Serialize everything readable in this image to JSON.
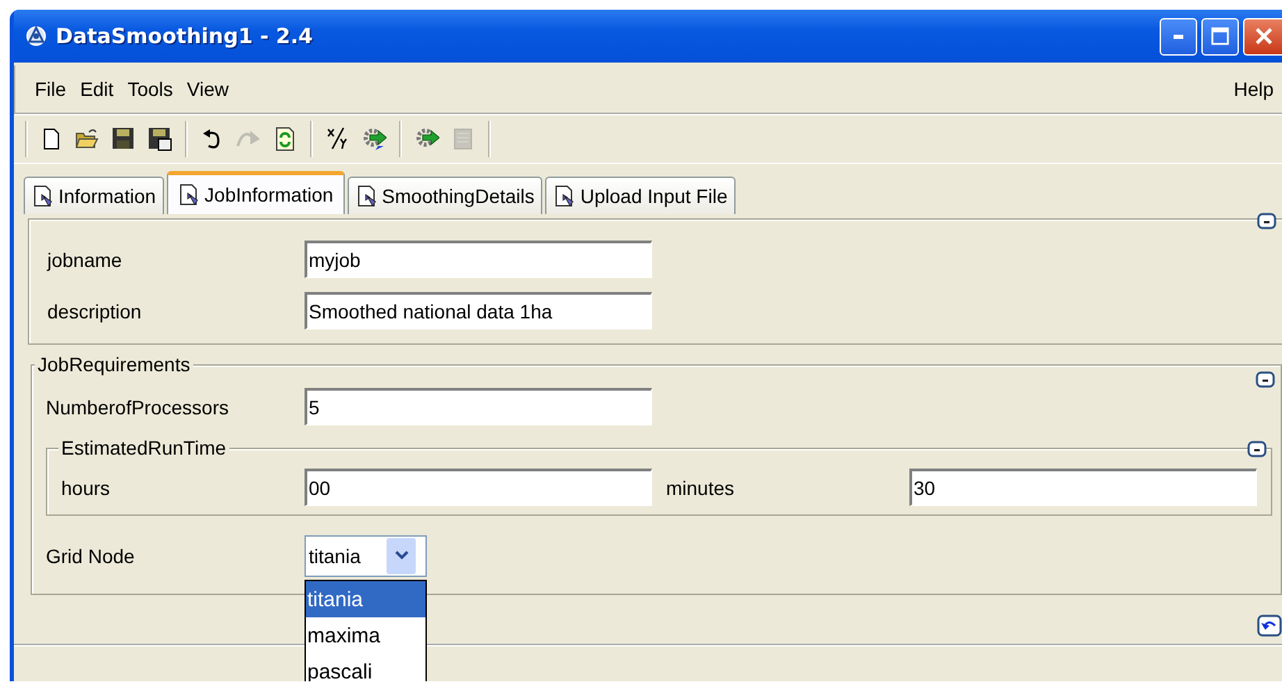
{
  "window": {
    "title": "DataSmoothing1 - 2.4"
  },
  "menu": {
    "items": [
      "File",
      "Edit",
      "Tools",
      "View"
    ],
    "help": "Help"
  },
  "toolbar": [
    {
      "kind": "new",
      "disabled": false
    },
    {
      "kind": "open",
      "disabled": false
    },
    {
      "kind": "save",
      "disabled": false
    },
    {
      "kind": "saveas",
      "disabled": false
    },
    {
      "kind": "separator"
    },
    {
      "kind": "undo",
      "disabled": false
    },
    {
      "kind": "redo",
      "disabled": true
    },
    {
      "kind": "refresh",
      "disabled": false
    },
    {
      "kind": "separator"
    },
    {
      "kind": "xy",
      "disabled": false
    },
    {
      "kind": "gearcheck",
      "disabled": false
    },
    {
      "kind": "separator"
    },
    {
      "kind": "gear",
      "disabled": false
    },
    {
      "kind": "doc",
      "disabled": true
    },
    {
      "kind": "separator"
    }
  ],
  "tabs": [
    {
      "label": "Information",
      "selected": false
    },
    {
      "label": "JobInformation",
      "selected": true
    },
    {
      "label": "SmoothingDetails",
      "selected": false
    },
    {
      "label": "Upload Input File",
      "selected": false
    }
  ],
  "job": {
    "fields": [
      {
        "label": "jobname",
        "value": "myjob"
      },
      {
        "label": "description",
        "value": "Smoothed national data 1ha"
      }
    ]
  },
  "requirements": {
    "title": "JobRequirements",
    "processors": {
      "label": "NumberofProcessors",
      "value": "5"
    },
    "runtime": {
      "title": "EstimatedRunTime",
      "hours": {
        "label": "hours",
        "value": "00"
      },
      "minutes": {
        "label": "minutes",
        "value": "30"
      }
    },
    "grid_node": {
      "label": "Grid Node",
      "value": "titania",
      "expanded": true,
      "options": [
        {
          "label": "titania",
          "selected": true
        },
        {
          "label": "maxima",
          "selected": false
        },
        {
          "label": "pascali",
          "selected": false
        }
      ]
    }
  }
}
